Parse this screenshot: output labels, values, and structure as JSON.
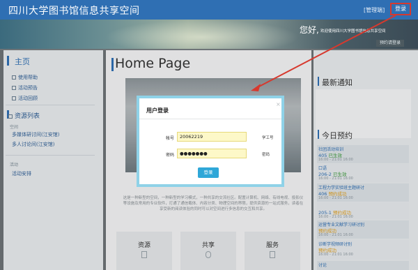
{
  "header": {
    "site_title": "四川大学图书馆信息共享空间",
    "admin_link": "[管理端]",
    "login_button": "登录"
  },
  "banner": {
    "greeting": "您好,",
    "welcome_text": "欢迎使用四川大学图书馆信息共享空间",
    "reserve_button": "预约请登录"
  },
  "sidebar": {
    "home_heading": "主页",
    "home_items": [
      "使用帮助",
      "活动预告",
      "活动回顾"
    ],
    "resource_heading": "资源列表",
    "group_space": "空间",
    "space_items": [
      "多媒体研讨间(江安馆)",
      "多人讨论间(江安馆)"
    ],
    "group_activity": "活动",
    "activity_items": [
      "活动安排"
    ]
  },
  "main": {
    "page_title": "Home Page",
    "description": "这是一种新型的空间，一种新型的学习模式，一种共享的交流社区。配置计算机、网络、有线电视、投影仪等设施及常用的专业软件，打通了通信载体、内容分类、物理空间的界限，提供资源的一站式服务，读者在享受新的阅读体验的同时可以对空间进行多信息的交互和共享。",
    "cards": [
      "资源",
      "共享",
      "服务"
    ]
  },
  "right": {
    "notice_heading": "最新通知",
    "today_heading": "今日预约",
    "bookings": [
      {
        "title": "社团活动培训",
        "status_prefix": "405",
        "status": "已生效",
        "status_color": "#3c9a3c",
        "time": "16:00 - 21:01 16:00"
      },
      {
        "title": "口语",
        "status_prefix": "206-2",
        "status": "已生效",
        "status_color": "#3c9a3c",
        "time": "16:00 - 21:01 16:00"
      },
      {
        "title": "工程力学实验班主题研讨",
        "status_prefix": "406",
        "status": "预约成功",
        "status_color": "#e0a020",
        "time": "16:00 - 21:01 16:00"
      },
      {
        "title": "",
        "status_prefix": "205-1",
        "status": "预约成功",
        "status_color": "#e0a020",
        "time": "16:00 - 21:01 16:00"
      },
      {
        "title": "运营专业文献学习研讨别",
        "status_prefix": "",
        "status": "预约成功",
        "status_color": "#e0a020",
        "time": "16:00 - 21:01 16:00"
      },
      {
        "title": "诊断学视频研讨别",
        "status_prefix": "",
        "status": "预约成功",
        "status_color": "#e0a020",
        "time": "16:00 - 21:01 16:00"
      },
      {
        "title": "讨论",
        "status_prefix": "",
        "status": "",
        "status_color": "#3c9a3c",
        "time": ""
      }
    ]
  },
  "login_modal": {
    "title": "用户登录",
    "close": "×",
    "account_label": "帐号",
    "account_value": "20062219",
    "account_hint": "学工号",
    "password_label": "密码",
    "password_value": "●●●●●●●",
    "password_hint": "密码",
    "submit": "登录"
  },
  "colors": {
    "topbar": "#2f6fb3",
    "accent": "#2fa7d8",
    "annotation": "#d7392e"
  }
}
